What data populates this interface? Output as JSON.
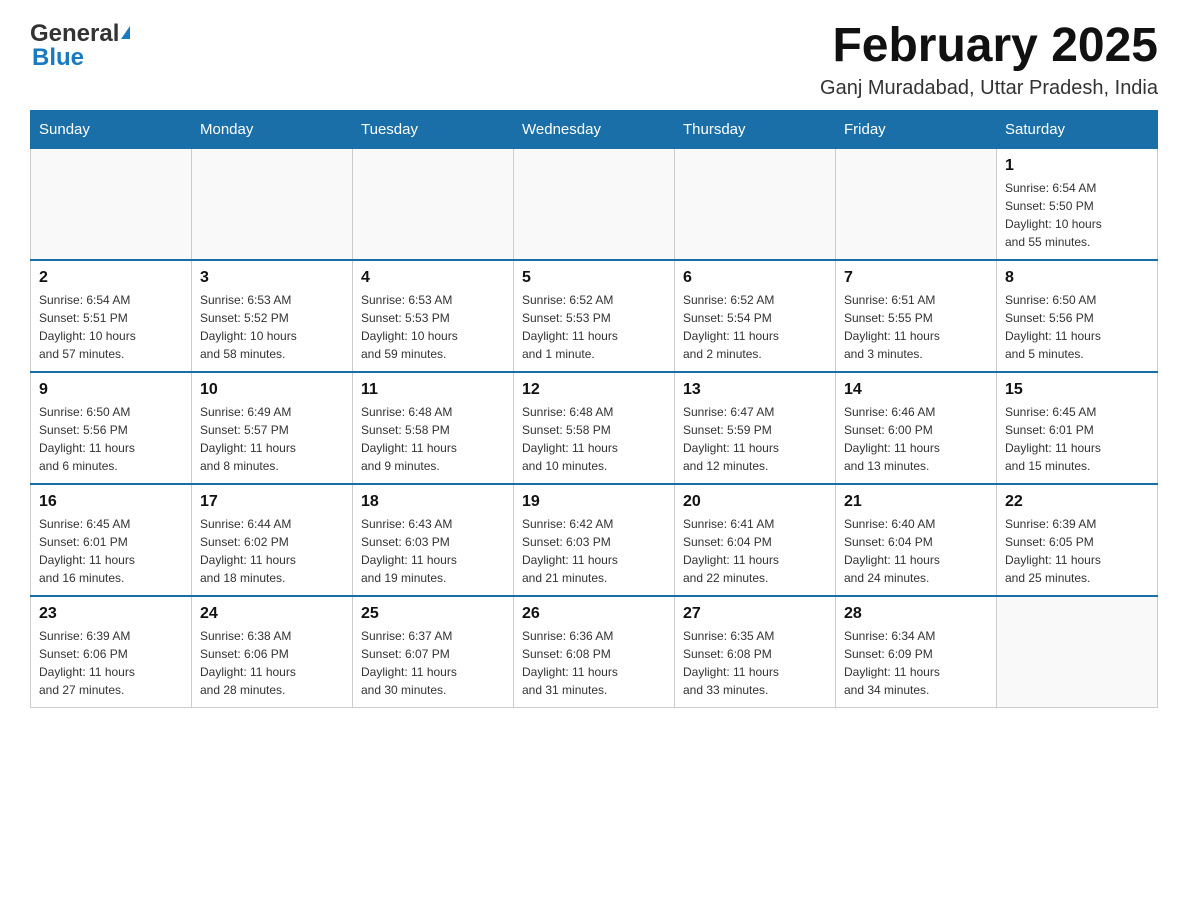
{
  "header": {
    "logo_general": "General",
    "logo_blue": "Blue",
    "title": "February 2025",
    "subtitle": "Ganj Muradabad, Uttar Pradesh, India"
  },
  "weekdays": [
    "Sunday",
    "Monday",
    "Tuesday",
    "Wednesday",
    "Thursday",
    "Friday",
    "Saturday"
  ],
  "weeks": [
    [
      {
        "day": "",
        "info": ""
      },
      {
        "day": "",
        "info": ""
      },
      {
        "day": "",
        "info": ""
      },
      {
        "day": "",
        "info": ""
      },
      {
        "day": "",
        "info": ""
      },
      {
        "day": "",
        "info": ""
      },
      {
        "day": "1",
        "info": "Sunrise: 6:54 AM\nSunset: 5:50 PM\nDaylight: 10 hours\nand 55 minutes."
      }
    ],
    [
      {
        "day": "2",
        "info": "Sunrise: 6:54 AM\nSunset: 5:51 PM\nDaylight: 10 hours\nand 57 minutes."
      },
      {
        "day": "3",
        "info": "Sunrise: 6:53 AM\nSunset: 5:52 PM\nDaylight: 10 hours\nand 58 minutes."
      },
      {
        "day": "4",
        "info": "Sunrise: 6:53 AM\nSunset: 5:53 PM\nDaylight: 10 hours\nand 59 minutes."
      },
      {
        "day": "5",
        "info": "Sunrise: 6:52 AM\nSunset: 5:53 PM\nDaylight: 11 hours\nand 1 minute."
      },
      {
        "day": "6",
        "info": "Sunrise: 6:52 AM\nSunset: 5:54 PM\nDaylight: 11 hours\nand 2 minutes."
      },
      {
        "day": "7",
        "info": "Sunrise: 6:51 AM\nSunset: 5:55 PM\nDaylight: 11 hours\nand 3 minutes."
      },
      {
        "day": "8",
        "info": "Sunrise: 6:50 AM\nSunset: 5:56 PM\nDaylight: 11 hours\nand 5 minutes."
      }
    ],
    [
      {
        "day": "9",
        "info": "Sunrise: 6:50 AM\nSunset: 5:56 PM\nDaylight: 11 hours\nand 6 minutes."
      },
      {
        "day": "10",
        "info": "Sunrise: 6:49 AM\nSunset: 5:57 PM\nDaylight: 11 hours\nand 8 minutes."
      },
      {
        "day": "11",
        "info": "Sunrise: 6:48 AM\nSunset: 5:58 PM\nDaylight: 11 hours\nand 9 minutes."
      },
      {
        "day": "12",
        "info": "Sunrise: 6:48 AM\nSunset: 5:58 PM\nDaylight: 11 hours\nand 10 minutes."
      },
      {
        "day": "13",
        "info": "Sunrise: 6:47 AM\nSunset: 5:59 PM\nDaylight: 11 hours\nand 12 minutes."
      },
      {
        "day": "14",
        "info": "Sunrise: 6:46 AM\nSunset: 6:00 PM\nDaylight: 11 hours\nand 13 minutes."
      },
      {
        "day": "15",
        "info": "Sunrise: 6:45 AM\nSunset: 6:01 PM\nDaylight: 11 hours\nand 15 minutes."
      }
    ],
    [
      {
        "day": "16",
        "info": "Sunrise: 6:45 AM\nSunset: 6:01 PM\nDaylight: 11 hours\nand 16 minutes."
      },
      {
        "day": "17",
        "info": "Sunrise: 6:44 AM\nSunset: 6:02 PM\nDaylight: 11 hours\nand 18 minutes."
      },
      {
        "day": "18",
        "info": "Sunrise: 6:43 AM\nSunset: 6:03 PM\nDaylight: 11 hours\nand 19 minutes."
      },
      {
        "day": "19",
        "info": "Sunrise: 6:42 AM\nSunset: 6:03 PM\nDaylight: 11 hours\nand 21 minutes."
      },
      {
        "day": "20",
        "info": "Sunrise: 6:41 AM\nSunset: 6:04 PM\nDaylight: 11 hours\nand 22 minutes."
      },
      {
        "day": "21",
        "info": "Sunrise: 6:40 AM\nSunset: 6:04 PM\nDaylight: 11 hours\nand 24 minutes."
      },
      {
        "day": "22",
        "info": "Sunrise: 6:39 AM\nSunset: 6:05 PM\nDaylight: 11 hours\nand 25 minutes."
      }
    ],
    [
      {
        "day": "23",
        "info": "Sunrise: 6:39 AM\nSunset: 6:06 PM\nDaylight: 11 hours\nand 27 minutes."
      },
      {
        "day": "24",
        "info": "Sunrise: 6:38 AM\nSunset: 6:06 PM\nDaylight: 11 hours\nand 28 minutes."
      },
      {
        "day": "25",
        "info": "Sunrise: 6:37 AM\nSunset: 6:07 PM\nDaylight: 11 hours\nand 30 minutes."
      },
      {
        "day": "26",
        "info": "Sunrise: 6:36 AM\nSunset: 6:08 PM\nDaylight: 11 hours\nand 31 minutes."
      },
      {
        "day": "27",
        "info": "Sunrise: 6:35 AM\nSunset: 6:08 PM\nDaylight: 11 hours\nand 33 minutes."
      },
      {
        "day": "28",
        "info": "Sunrise: 6:34 AM\nSunset: 6:09 PM\nDaylight: 11 hours\nand 34 minutes."
      },
      {
        "day": "",
        "info": ""
      }
    ]
  ]
}
